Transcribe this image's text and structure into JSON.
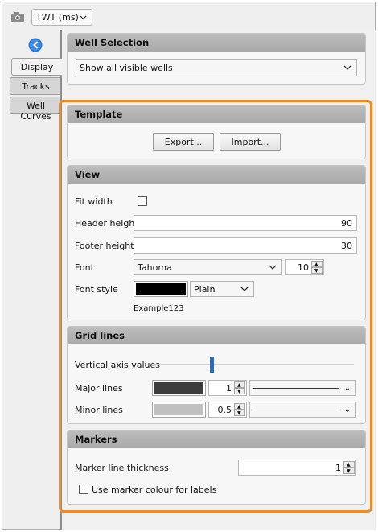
{
  "toolbar": {
    "domain_value": "TWT (ms)",
    "camera_icon": "camera-icon"
  },
  "tabs": [
    {
      "label": "Display",
      "active": true
    },
    {
      "label": "Tracks",
      "active": false
    },
    {
      "label": "Well Curves",
      "active": false
    }
  ],
  "well_selection": {
    "title": "Well Selection",
    "value": "Show all visible wells"
  },
  "template": {
    "title": "Template",
    "export_label": "Export...",
    "import_label": "Import..."
  },
  "view": {
    "title": "View",
    "fit_width_label": "Fit width",
    "header_height_label": "Header height",
    "header_height_value": "90",
    "footer_height_label": "Footer height",
    "footer_height_value": "30",
    "font_label": "Font",
    "font_value": "Tahoma",
    "font_size_value": "10",
    "font_style_label": "Font style",
    "font_color": "#000000",
    "font_style_value": "Plain",
    "example_text": "Example123"
  },
  "grid_lines": {
    "title": "Grid lines",
    "vertical_axis_label": "Vertical axis values",
    "major_label": "Major lines",
    "major_color": "#3c3c3c",
    "major_value": "1",
    "minor_label": "Minor lines",
    "minor_color": "#c0c0c0",
    "minor_value": "0.5"
  },
  "markers": {
    "title": "Markers",
    "thickness_label": "Marker line thickness",
    "thickness_value": "1",
    "use_colour_label": "Use marker colour for labels"
  },
  "colors": {
    "highlight": "#f08a24",
    "accent": "#1f6fc7"
  }
}
